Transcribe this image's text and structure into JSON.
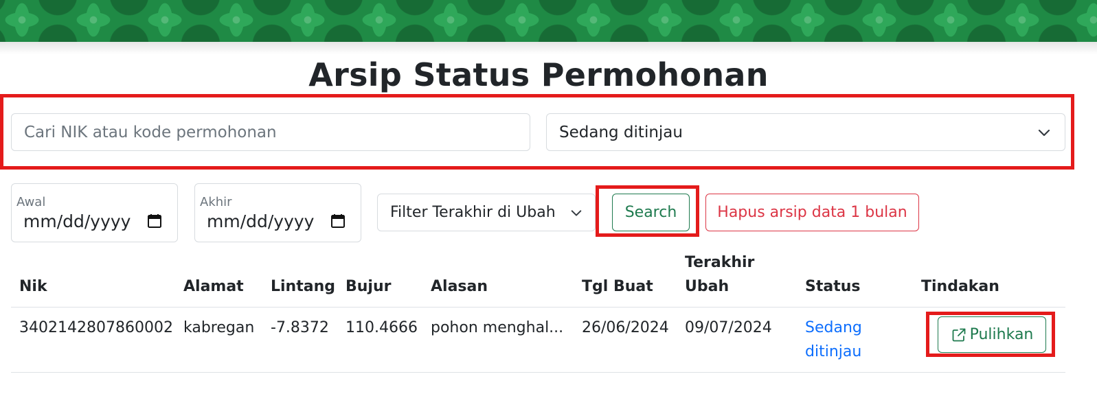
{
  "header": {
    "title": "Arsip Status Permohonan"
  },
  "filters": {
    "search_placeholder": "Cari NIK atau kode permohonan",
    "status_selected": "Sedang ditinjau",
    "date_start_label": "Awal",
    "date_start_value": "mm/dd/yyyy",
    "date_end_label": "Akhir",
    "date_end_value": "mm/dd/yyyy",
    "sort_selected": "Filter Terakhir di Ubah",
    "search_button": "Search",
    "delete_button": "Hapus arsip data 1 bulan"
  },
  "table": {
    "headers": {
      "nik": "Nik",
      "alamat": "Alamat",
      "lintang": "Lintang",
      "bujur": "Bujur",
      "alasan": "Alasan",
      "tgl_buat": "Tgl Buat",
      "terakhir_ubah_1": "Terakhir",
      "terakhir_ubah_2": "Ubah",
      "status": "Status",
      "tindakan": "Tindakan"
    },
    "rows": [
      {
        "nik": "3402142807860002",
        "alamat": "kabregan",
        "lintang": "-7.8372",
        "bujur": "110.4666",
        "alasan": "pohon menghal...",
        "tgl_buat": "26/06/2024",
        "terakhir_ubah": "09/07/2024",
        "status_1": "Sedang",
        "status_2": "ditinjau",
        "action": "Pulihkan"
      }
    ]
  },
  "colors": {
    "primary_green": "#1e7a4e",
    "danger_red": "#dc3545",
    "link_blue": "#0d6efd",
    "highlight_red": "#e41b1b",
    "banner_green": "#1f8a45"
  }
}
